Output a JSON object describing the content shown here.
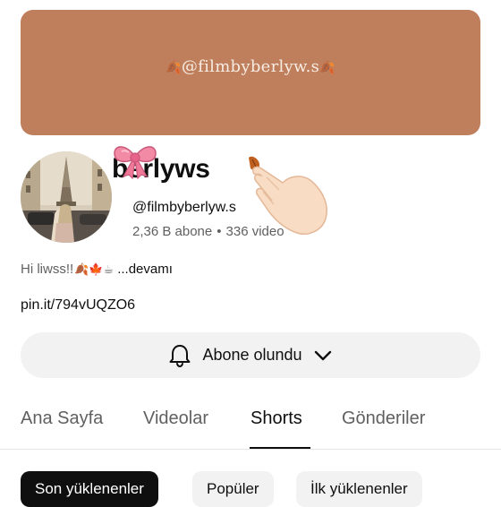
{
  "banner": {
    "text": "@filmbyberlyw.s",
    "leaf_glyph": "🍂"
  },
  "channel": {
    "name": "berlyws",
    "handle": "@filmbyberlyw.s",
    "subscribers": "2,36 B abone",
    "separator": "•",
    "videos": "336 video",
    "description": "Hi liwss!!",
    "description_emojis": "🍂🍁☕",
    "more_label": "...devamı",
    "link": "pin.it/794vUQZO6"
  },
  "subscribe_button": {
    "label": "Abone olundu"
  },
  "tabs": [
    "Ana Sayfa",
    "Videolar",
    "Shorts",
    "Gönderiler"
  ],
  "active_tab": "Shorts",
  "chips": [
    "Son yüklenenler",
    "Popüler",
    "İlk yüklenenler"
  ],
  "selected_chip": "Son yüklenenler",
  "colors": {
    "banner": "#bf7f5c",
    "text": "#0f0f0f",
    "secondary": "#606060",
    "button_bg": "#f2f2f2"
  },
  "icons": [
    "bell-icon",
    "chevron-down-icon",
    "bow-sticker-icon",
    "hand-sticker-icon"
  ]
}
